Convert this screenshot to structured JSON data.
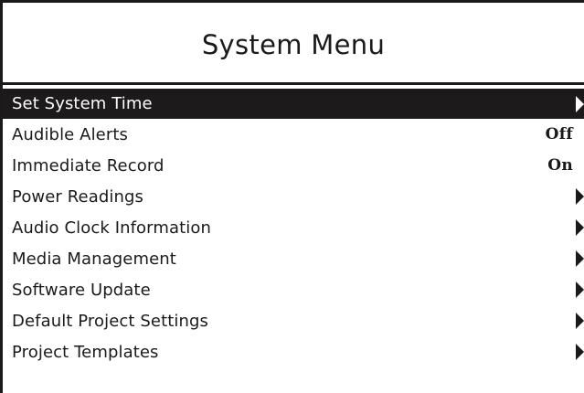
{
  "menu": {
    "title": "System Menu",
    "items": [
      {
        "label": "Set System Time",
        "value": "",
        "arrow": true,
        "selected": true
      },
      {
        "label": "Audible Alerts",
        "value": "Off",
        "arrow": false,
        "selected": false
      },
      {
        "label": "Immediate Record",
        "value": "On",
        "arrow": false,
        "selected": false
      },
      {
        "label": "Power Readings",
        "value": "",
        "arrow": true,
        "selected": false
      },
      {
        "label": "Audio Clock Information",
        "value": "",
        "arrow": true,
        "selected": false
      },
      {
        "label": "Media Management",
        "value": "",
        "arrow": true,
        "selected": false
      },
      {
        "label": "Software Update",
        "value": "",
        "arrow": true,
        "selected": false
      },
      {
        "label": "Default Project Settings",
        "value": "",
        "arrow": true,
        "selected": false
      },
      {
        "label": "Project Templates",
        "value": "",
        "arrow": true,
        "selected": false
      }
    ]
  },
  "icons": {
    "arrow": "arrow-right-icon"
  },
  "colors": {
    "background": "#ffffff",
    "foreground": "#1a1a1a",
    "highlight": "#1c1a1a",
    "highlight_text": "#ffffff"
  }
}
